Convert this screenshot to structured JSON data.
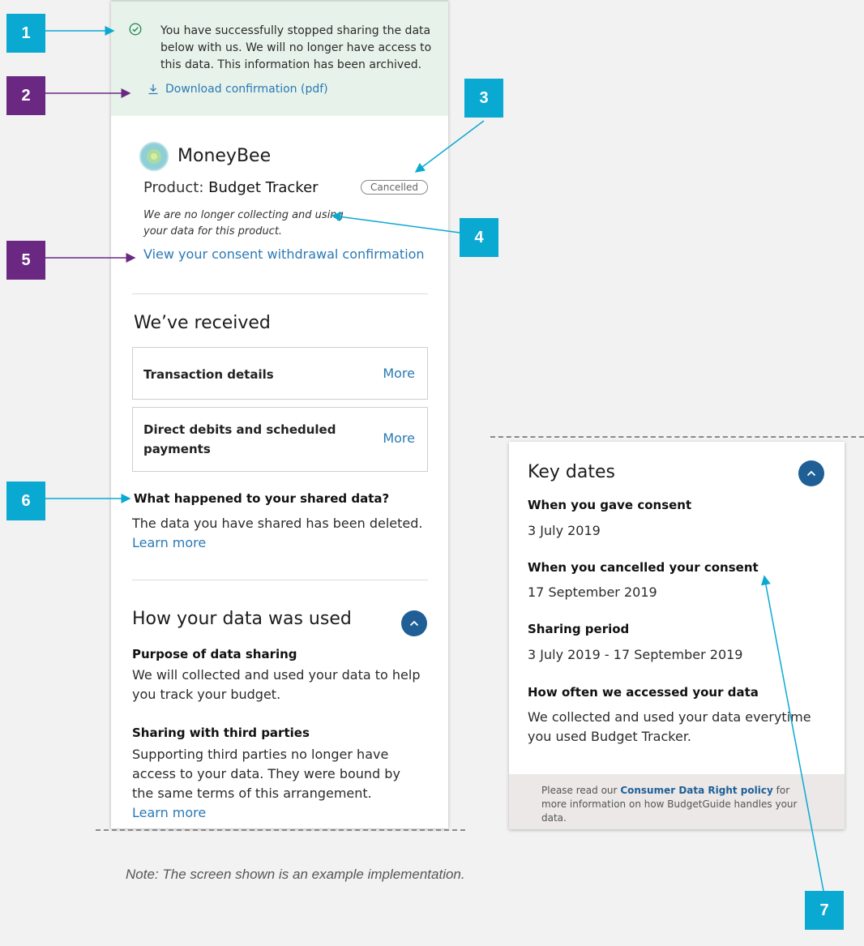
{
  "success": {
    "message": "You have successfully stopped sharing the data below with us. We will no longer have access to this data. This information has been archived.",
    "download_label": "Download confirmation (pdf)"
  },
  "brand": {
    "name": "MoneyBee"
  },
  "product": {
    "prefix": "Product:",
    "name": "Budget Tracker",
    "status": "Cancelled",
    "status_note": "We are no longer collecting and using your data for this product.",
    "consent_link": "View your consent withdrawal confirmation"
  },
  "received": {
    "heading": "We’ve received",
    "items": [
      {
        "label": "Transaction details",
        "more": "More"
      },
      {
        "label": "Direct debits and scheduled payments",
        "more": "More"
      }
    ],
    "question": "What happened to your shared data?",
    "answer": "The data you have shared has been deleted.",
    "learn_more": "Learn more"
  },
  "usage": {
    "heading": "How your data was used",
    "purpose_title": "Purpose of data sharing",
    "purpose_text": "We will collected and used your data to help you track your budget.",
    "third_title": "Sharing with third parties",
    "third_text": "Supporting third parties no longer have access to your data. They were bound by the same terms of this arrangement.",
    "learn_more": "Learn more"
  },
  "key_dates": {
    "heading": "Key dates",
    "gave_label": "When you gave consent",
    "gave_value": "3 July 2019",
    "cancelled_label": "When you cancelled your consent",
    "cancelled_value": "17 September 2019",
    "period_label": "Sharing period",
    "period_value": "3 July 2019 - 17 September 2019",
    "often_label": "How often we accessed your data",
    "often_value": "We collected and used your data everytime you used Budget Tracker.",
    "footer_pre": "Please read our",
    "footer_link": "Consumer Data Right policy",
    "footer_post": "for more information on how BudgetGuide handles your data."
  },
  "markers": [
    "1",
    "2",
    "3",
    "4",
    "5",
    "6",
    "7"
  ],
  "note": "Note: The screen shown is an example implementation.",
  "colors": {
    "teal_marker": "#0aa9d2",
    "purple_marker": "#6b2883",
    "link": "#2a79b5",
    "success_bg": "#e7f3ea"
  }
}
